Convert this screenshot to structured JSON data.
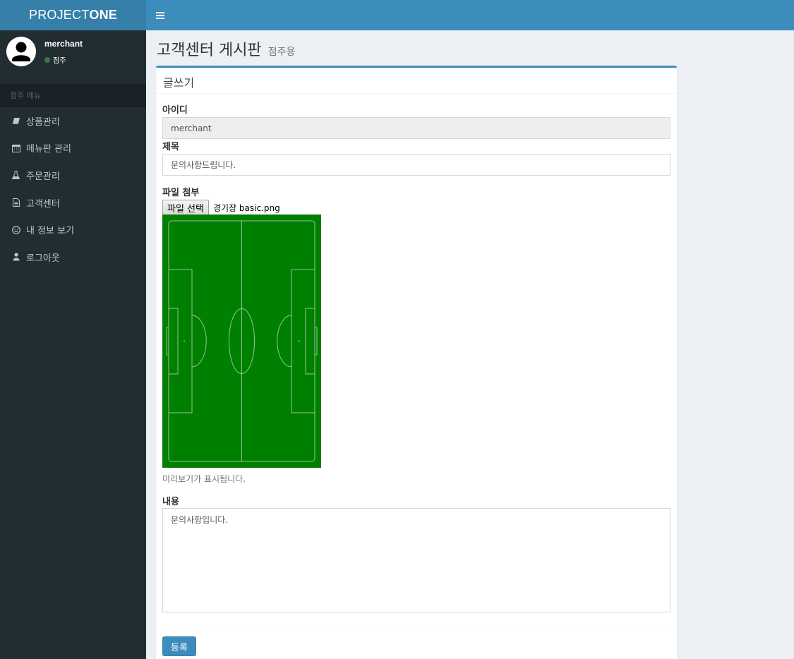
{
  "header": {
    "logo_regular": "PROJECT",
    "logo_bold": "ONE",
    "menu_toggle_icon": "hamburger-icon"
  },
  "sidebar": {
    "user_name": "merchant",
    "user_status": "점주",
    "section_header": "점주 메뉴",
    "items": [
      {
        "label": "상품관리",
        "icon": "book-icon"
      },
      {
        "label": "메뉴판 관리",
        "icon": "calendar-icon"
      },
      {
        "label": "주문관리",
        "icon": "flask-icon"
      },
      {
        "label": "고객센터",
        "icon": "document-icon"
      },
      {
        "label": "내 정보 보기",
        "icon": "smile-icon"
      },
      {
        "label": "로그아웃",
        "icon": "user-icon"
      }
    ]
  },
  "page": {
    "title": "고객센터 게시판",
    "subtitle": "점주용"
  },
  "form": {
    "box_title": "글쓰기",
    "id_label": "아이디",
    "id_value": "merchant",
    "subject_label": "제목",
    "subject_value": "문의사항드립니다.",
    "file_label": "파일 첨부",
    "file_button": "파일 선택",
    "file_name": "경기장 basic.png",
    "preview_help": "미리보기가 표시됩니다.",
    "content_label": "내용",
    "content_value": "문의사항입니다.",
    "submit_label": "등록"
  },
  "colors": {
    "brand": "#3c8dbc",
    "sidebar_bg": "#222d32",
    "pitch_green": "#008000"
  }
}
